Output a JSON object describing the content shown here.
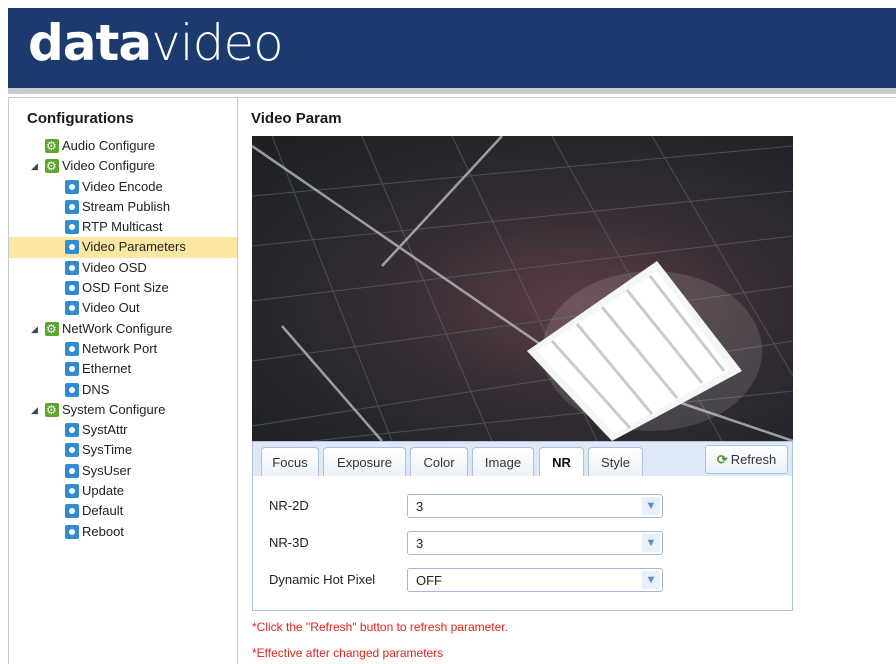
{
  "brand": {
    "logo_prefix": "data",
    "logo_suffix": "video"
  },
  "sidebar": {
    "title": "Configurations",
    "items": [
      {
        "label": "Audio Configure",
        "level": 1,
        "icon": "gear-icon"
      },
      {
        "label": "Video Configure",
        "level": 1,
        "icon": "gear-icon",
        "expanded": true
      },
      {
        "label": "Video Encode",
        "level": 2,
        "icon": "item-icon"
      },
      {
        "label": "Stream Publish",
        "level": 2,
        "icon": "item-icon"
      },
      {
        "label": "RTP Multicast",
        "level": 2,
        "icon": "item-icon"
      },
      {
        "label": "Video Parameters",
        "level": 2,
        "icon": "item-icon",
        "selected": true
      },
      {
        "label": "Video OSD",
        "level": 2,
        "icon": "item-icon"
      },
      {
        "label": "OSD Font Size",
        "level": 2,
        "icon": "item-icon"
      },
      {
        "label": "Video Out",
        "level": 2,
        "icon": "item-icon"
      },
      {
        "label": "NetWork Configure",
        "level": 1,
        "icon": "gear-icon",
        "expanded": true
      },
      {
        "label": "Network Port",
        "level": 2,
        "icon": "item-icon"
      },
      {
        "label": "Ethernet",
        "level": 2,
        "icon": "item-icon"
      },
      {
        "label": "DNS",
        "level": 2,
        "icon": "item-icon"
      },
      {
        "label": "System Configure",
        "level": 1,
        "icon": "gear-icon",
        "expanded": true
      },
      {
        "label": "SystAttr",
        "level": 2,
        "icon": "item-icon"
      },
      {
        "label": "SysTime",
        "level": 2,
        "icon": "item-icon"
      },
      {
        "label": "SysUser",
        "level": 2,
        "icon": "item-icon"
      },
      {
        "label": "Update",
        "level": 2,
        "icon": "item-icon"
      },
      {
        "label": "Default",
        "level": 2,
        "icon": "item-icon"
      },
      {
        "label": "Reboot",
        "level": 2,
        "icon": "item-icon"
      }
    ]
  },
  "main": {
    "title": "Video Param",
    "tabs": [
      "Focus",
      "Exposure",
      "Color",
      "Image",
      "NR",
      "Style"
    ],
    "active_tab": "NR",
    "refresh_label": "Refresh",
    "fields": [
      {
        "label": "NR-2D",
        "value": "3"
      },
      {
        "label": "NR-3D",
        "value": "3"
      },
      {
        "label": "Dynamic Hot Pixel",
        "value": "OFF"
      }
    ],
    "notes": [
      "*Click the \"Refresh\" button to refresh parameter.",
      "*Effective after changed parameters"
    ]
  },
  "colors": {
    "header": "#1d3a6e",
    "selected": "#fbe7a1",
    "note": "#e2231a",
    "tab_border": "#aac2e0"
  }
}
